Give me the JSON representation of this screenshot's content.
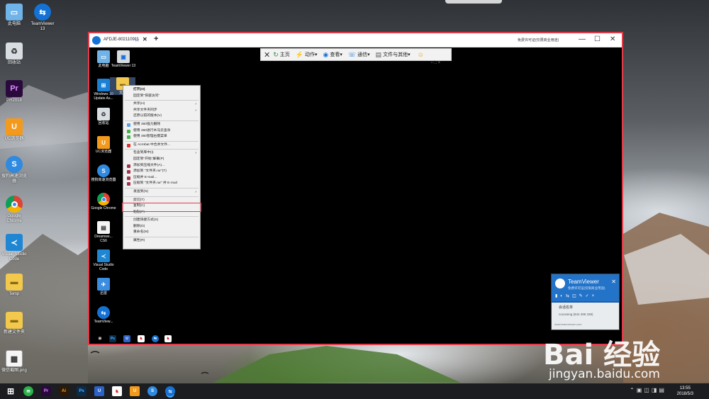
{
  "desktop": {
    "icons": [
      {
        "label": "此电脑",
        "icon": "computer-icon"
      },
      {
        "label": "TeamViewer 13",
        "icon": "teamviewer-icon"
      },
      {
        "label": "回收站",
        "icon": "recycle-bin-icon"
      },
      {
        "label": "PR2018",
        "icon": "premiere-icon"
      },
      {
        "label": "UC浏览器",
        "icon": "uc-browser-icon"
      },
      {
        "label": "搜狗高速浏览器",
        "icon": "sogou-browser-icon"
      },
      {
        "label": "Google Chrome",
        "icon": "chrome-icon"
      },
      {
        "label": "Visual Studio Code",
        "icon": "vscode-icon"
      },
      {
        "label": "Temp",
        "icon": "folder-icon"
      },
      {
        "label": "新建文件夹",
        "icon": "folder-icon"
      },
      {
        "label": "微信截图.png",
        "icon": "image-file-icon"
      }
    ]
  },
  "remote_window": {
    "tab_title": "AFDJE-802110911",
    "notice": "免费许可证(仅限商业用途)",
    "toolbar": [
      {
        "label": "主页",
        "icon": "home-icon"
      },
      {
        "label": "动作",
        "icon": "lightning-icon"
      },
      {
        "label": "查看",
        "icon": "eye-icon"
      },
      {
        "label": "通信",
        "icon": "communication-icon"
      },
      {
        "label": "文件与其他",
        "icon": "file-icon"
      }
    ],
    "icons": [
      {
        "label": "此电脑",
        "icon": "computer-icon"
      },
      {
        "label": "TeamViewer 13",
        "icon": "teamviewer-icon"
      },
      {
        "label": "Windows 10 Update As...",
        "icon": "windows-icon"
      },
      {
        "label": "文件",
        "icon": "folder-icon"
      },
      {
        "label": "回收站",
        "icon": "recycle-bin-icon"
      },
      {
        "label": "UC浏览器",
        "icon": "uc-browser-icon"
      },
      {
        "label": "搜狗高速浏览器",
        "icon": "sogou-browser-icon"
      },
      {
        "label": "Google Chrome",
        "icon": "chrome-icon"
      },
      {
        "label": "Dreamwe... CS6",
        "icon": "file-icon"
      },
      {
        "label": "Visual Studio Code",
        "icon": "vscode-icon"
      },
      {
        "label": "迅雷",
        "icon": "xunlei-icon"
      },
      {
        "label": "TeamView...",
        "icon": "teamviewer-icon"
      }
    ],
    "context_menu": [
      {
        "label": "打开(O)",
        "bold": true
      },
      {
        "label": "固定到\"快速访问\""
      },
      {
        "sep": true
      },
      {
        "label": "共享(H)",
        "submenu": true
      },
      {
        "label": "共享文件夹同步",
        "submenu": true
      },
      {
        "label": "还原以前的版本(V)"
      },
      {
        "sep": true
      },
      {
        "label": "使用 360强力删除",
        "icon_color": "#5aa0e8"
      },
      {
        "label": "使用 360进行木马云查杀",
        "icon_color": "#43b24a"
      },
      {
        "label": "使用 360管理右键菜单",
        "icon_color": "#43b24a"
      },
      {
        "sep": true
      },
      {
        "label": "在 Acrobat 中合并文件...",
        "icon_color": "#d8332f"
      },
      {
        "sep": true
      },
      {
        "label": "包含到库中(I)",
        "submenu": true
      },
      {
        "label": "固定到\"开始\"屏幕(P)"
      },
      {
        "label": "添加到压缩文件(A)...",
        "icon_color": "#a1324c"
      },
      {
        "label": "添加到 \"文件夹.rar\"(T)",
        "icon_color": "#a1324c"
      },
      {
        "label": "压缩并 E-mail...",
        "icon_color": "#a1324c"
      },
      {
        "label": "压缩到 \"文件夹.rar\" 并 E-mail",
        "icon_color": "#a1324c"
      },
      {
        "sep": true
      },
      {
        "label": "发送到(N)",
        "submenu": true
      },
      {
        "sep": true
      },
      {
        "label": "剪切(T)"
      },
      {
        "label": "复制(C)"
      },
      {
        "label": "粘贴(P)"
      },
      {
        "sep": true
      },
      {
        "label": "创建快捷方式(S)"
      },
      {
        "label": "删除(D)"
      },
      {
        "label": "重命名(M)"
      },
      {
        "sep": true
      },
      {
        "label": "属性(R)"
      }
    ],
    "tv_panel": {
      "title": "TeamViewer",
      "subtitle": "免费许可证(仅限商业用途)",
      "list_header": "会话名单",
      "list_item": "cocoseng (844 296 338)",
      "footer": "www.teamviewer.com"
    }
  },
  "taskbar": {
    "time": "13:55",
    "date": "2018/5/3"
  },
  "watermark": {
    "brand": "Bai 经验",
    "url": "jingyan.baidu.com"
  }
}
